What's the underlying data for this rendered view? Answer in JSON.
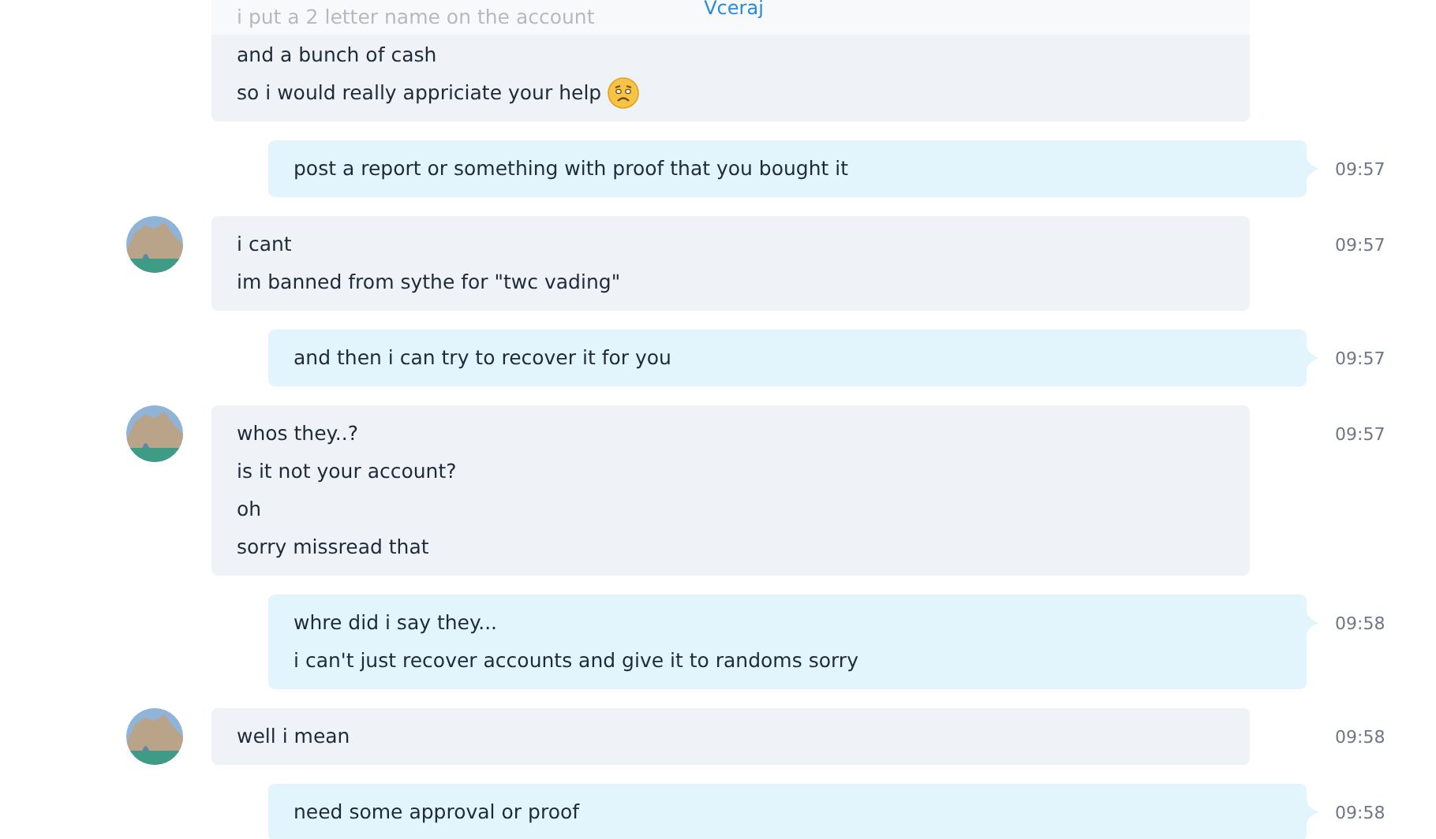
{
  "date_header": "Vceraj",
  "messages": [
    {
      "kind": "incoming",
      "avatar": false,
      "faded_lines": [
        "i put a 2 letter name on the account"
      ],
      "lines": [
        "and a bunch of cash",
        "so i would really appriciate your help"
      ],
      "emoji": true
    },
    {
      "kind": "outgoing",
      "lines": [
        "post a report or something with proof that you bought it"
      ],
      "time": "09:57"
    },
    {
      "kind": "incoming",
      "avatar": true,
      "lines": [
        "i cant",
        "im banned from sythe for \"twc vading\""
      ],
      "time": "09:57"
    },
    {
      "kind": "outgoing",
      "lines": [
        "and then i can try to recover it for you"
      ],
      "time": "09:57"
    },
    {
      "kind": "incoming",
      "avatar": true,
      "lines": [
        "whos they..?",
        "is it not your account?",
        "oh",
        "sorry missread that"
      ],
      "time": "09:57"
    },
    {
      "kind": "outgoing",
      "lines": [
        "whre did i say they...",
        "i can't just recover accounts and give it to randoms sorry"
      ],
      "time": "09:58"
    },
    {
      "kind": "incoming",
      "avatar": true,
      "lines": [
        "well i mean"
      ],
      "time": "09:58"
    },
    {
      "kind": "outgoing",
      "lines": [
        "need some approval or proof"
      ],
      "time": "09:58"
    }
  ]
}
